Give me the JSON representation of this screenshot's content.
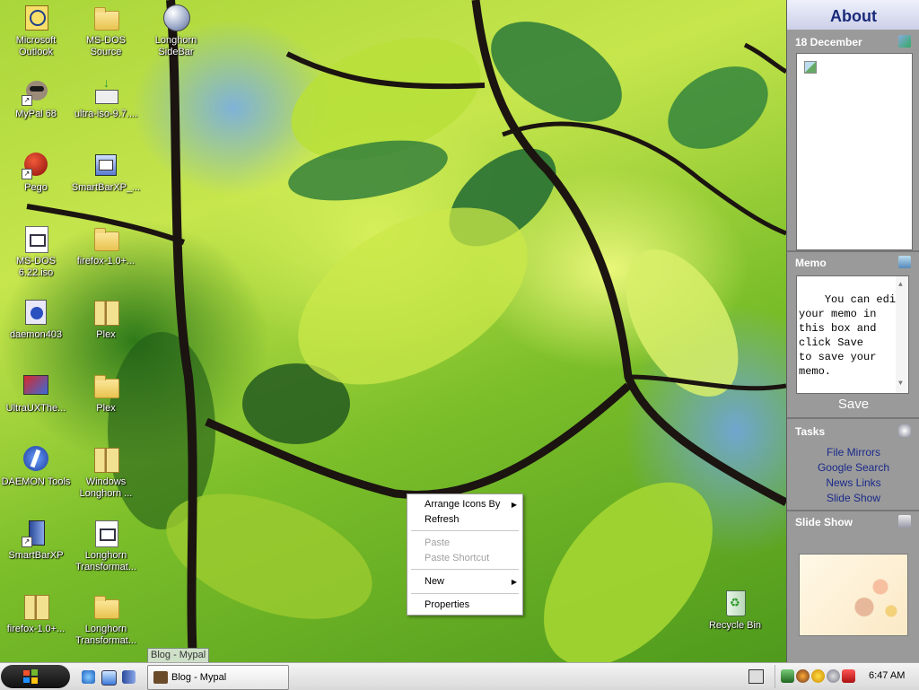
{
  "desktop": {
    "icons": [
      {
        "label": "Microsoft Outlook",
        "icon": "outlook-icon"
      },
      {
        "label": "MS-DOS Source",
        "icon": "folder-icon"
      },
      {
        "label": "Longhorn SideBar",
        "icon": "sidebar-app-icon"
      },
      {
        "label": "MyPal 68",
        "icon": "mypal-icon"
      },
      {
        "label": "ultra-iso-9.7....",
        "icon": "download-file-icon"
      },
      {
        "label": "Pego",
        "icon": "pego-icon"
      },
      {
        "label": "SmartBarXP_...",
        "icon": "installer-icon"
      },
      {
        "label": "MS-DOS 6.22.iso",
        "icon": "iso-file-icon"
      },
      {
        "label": "firefox-1.0+...",
        "icon": "folder-icon"
      },
      {
        "label": "daemon403",
        "icon": "daemon-installer-icon"
      },
      {
        "label": "Plex",
        "icon": "zip-folder-icon"
      },
      {
        "label": "UltraUXThe...",
        "icon": "ultraux-icon"
      },
      {
        "label": "Plex",
        "icon": "folder-icon"
      },
      {
        "label": "DAEMON Tools",
        "icon": "daemon-tools-icon"
      },
      {
        "label": "Windows Longhorn ...",
        "icon": "zip-folder-icon"
      },
      {
        "label": "SmartBarXP",
        "icon": "smartbar-icon"
      },
      {
        "label": "Longhorn Transformat...",
        "icon": "doc-file-icon"
      },
      {
        "label": "firefox-1.0+...",
        "icon": "zip-folder-icon"
      },
      {
        "label": "Longhorn Transformat...",
        "icon": "folder-icon"
      }
    ],
    "recycle_bin": {
      "label": "Recycle Bin",
      "icon": "recycle-bin-icon"
    }
  },
  "context_menu": {
    "arrange": "Arrange Icons By",
    "refresh": "Refresh",
    "paste": "Paste",
    "paste_shortcut": "Paste Shortcut",
    "new": "New",
    "properties": "Properties"
  },
  "tooltip": "Blog - Mypal",
  "sidebar": {
    "title": "About",
    "calendar": {
      "date": "18 December"
    },
    "memo": {
      "title": "Memo",
      "text": "You can edit\nyour memo in\nthis box and\nclick Save\nto save your\nmemo.",
      "save": "Save"
    },
    "tasks": {
      "title": "Tasks",
      "links": [
        "File Mirrors",
        "Google Search",
        "News Links",
        "Slide Show"
      ]
    },
    "slideshow": {
      "title": "Slide Show"
    }
  },
  "taskbar": {
    "task_button": "Blog - Mypal",
    "clock": "6:47 AM"
  }
}
